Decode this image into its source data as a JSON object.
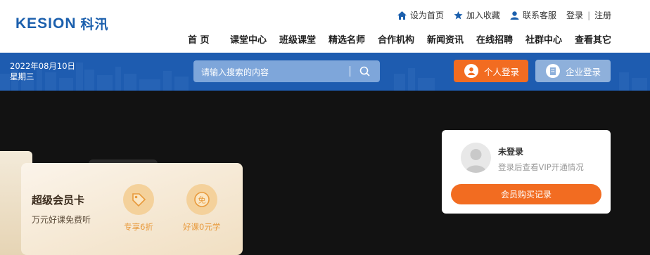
{
  "header": {
    "logo_en": "KESION",
    "logo_cn": "科汛",
    "top_links": [
      {
        "label": "设为首页",
        "icon": "home-icon"
      },
      {
        "label": "加入收藏",
        "icon": "star-icon"
      },
      {
        "label": "联系客服",
        "icon": "user-icon"
      }
    ],
    "login": "登录",
    "separator": "|",
    "register": "注册",
    "nav": [
      "首 页",
      "课堂中心",
      "班级课堂",
      "精选名师",
      "合作机构",
      "新闻资讯",
      "在线招聘",
      "社群中心",
      "查看其它"
    ]
  },
  "bar": {
    "date": "2022年08月10日",
    "weekday": "星期三",
    "search_placeholder": "请输入搜索的内容",
    "personal_login": "个人登录",
    "company_login": "企业登录"
  },
  "hero": {
    "card_title": "超级会员卡",
    "card_subtitle": "万元好课免费听",
    "perks": [
      {
        "label": "专享6折",
        "icon": "discount-tag-icon"
      },
      {
        "label": "好课0元学",
        "icon": "free-badge-icon"
      }
    ],
    "perk_free_glyph": "免"
  },
  "user_panel": {
    "status": "未登录",
    "hint": "登录后查看VIP开通情况",
    "button": "会员购买记录"
  },
  "colors": {
    "brand_blue": "#1b5fad",
    "bar_blue": "#1e5cb0",
    "accent_orange": "#f26c21",
    "hero_bg": "#121212"
  }
}
